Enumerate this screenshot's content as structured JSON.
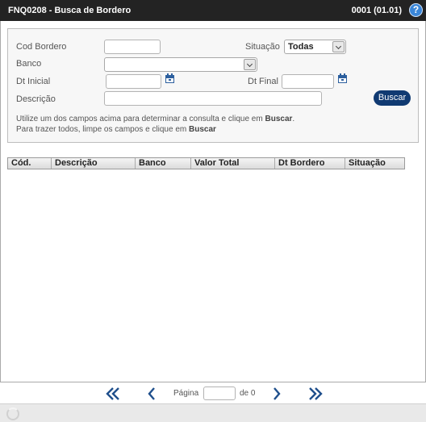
{
  "header": {
    "title": "FNQ0208 - Busca de Bordero",
    "version": "0001 (01.01)",
    "help_icon": "help-icon"
  },
  "form": {
    "cod_bordero_label": "Cod Bordero",
    "cod_bordero_value": "",
    "situacao_label": "Situação",
    "situacao_value": "Todas",
    "banco_label": "Banco",
    "banco_value": "",
    "dt_inicial_label": "Dt Inicial",
    "dt_inicial_value": "",
    "dt_final_label": "Dt Final",
    "dt_final_value": "",
    "descricao_label": "Descrição",
    "descricao_value": "",
    "buscar_label": "Buscar",
    "hint_line1_prefix": "Utilize um dos campos acima para determinar a consulta e clique em ",
    "hint_line1_bold": "Buscar",
    "hint_line1_suffix": ".",
    "hint_line2_prefix": "Para trazer todos, limpe os campos e clique em ",
    "hint_line2_bold": "Buscar"
  },
  "grid": {
    "columns": [
      "Cód.",
      "Descrição",
      "Banco",
      "Valor Total",
      "Dt Bordero",
      "Situação"
    ],
    "rows": []
  },
  "pager": {
    "page_label": "Página",
    "page_value": "",
    "of_label": "de 0"
  },
  "colors": {
    "titlebar": "#232323",
    "accent": "#103a72",
    "pager_icons": "#1f4f8c"
  }
}
